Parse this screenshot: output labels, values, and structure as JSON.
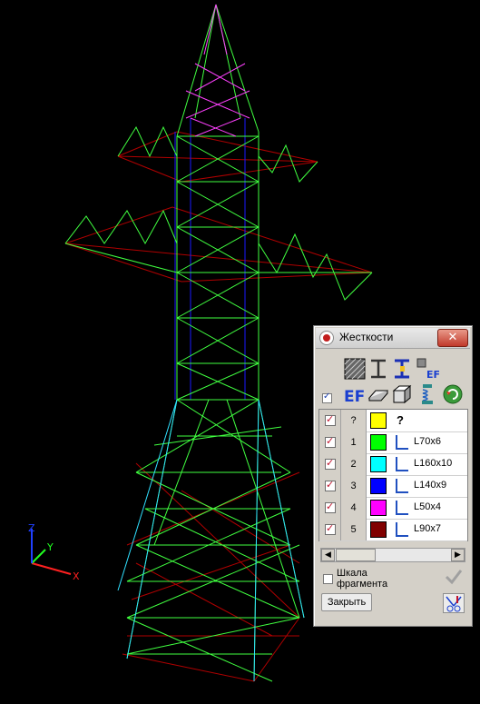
{
  "dialog": {
    "title": "Жесткости",
    "close_glyph": "✕",
    "toolbar_row1": [
      {
        "icon": "hatch-section-icon"
      },
      {
        "icon": "i-beam-icon"
      },
      {
        "icon": "i-beam-colored-icon"
      },
      {
        "icon": "ef-small-icon",
        "text": "EF"
      }
    ],
    "toolbar_row2": [
      {
        "icon": "ef-large-icon",
        "text": "EF"
      },
      {
        "icon": "plate-icon"
      },
      {
        "icon": "box-3d-icon"
      },
      {
        "icon": "spring-icon"
      },
      {
        "icon": "refresh-arrow-icon"
      }
    ],
    "select_all_checked": true,
    "rows": [
      {
        "checked": true,
        "number": "?",
        "color": "#ffff00",
        "shape": "unknown",
        "name": "?"
      },
      {
        "checked": true,
        "number": "1",
        "color": "#00ff00",
        "shape": "angle",
        "name": "L70x6"
      },
      {
        "checked": true,
        "number": "2",
        "color": "#00ffff",
        "shape": "angle",
        "name": "L160x10"
      },
      {
        "checked": true,
        "number": "3",
        "color": "#0000ff",
        "shape": "angle",
        "name": "L140x9"
      },
      {
        "checked": true,
        "number": "4",
        "color": "#ff00ff",
        "shape": "angle",
        "name": "L50x4"
      },
      {
        "checked": true,
        "number": "5",
        "color": "#800000",
        "shape": "angle",
        "name": "L90x7"
      }
    ],
    "scale_label": "Шкала фрагмента",
    "scale_checked": false,
    "close_button": "Закрыть",
    "scroll_left": "◀",
    "scroll_right": "▶"
  },
  "axes": {
    "x_label": "X",
    "y_label": "Y",
    "z_label": "Z",
    "x_color": "#ff2020",
    "y_color": "#20ff20",
    "z_color": "#2040ff"
  },
  "model": {
    "background": "#000000",
    "colors": {
      "green": "#40ff40",
      "red": "#c00000",
      "blue": "#1a1aff",
      "magenta": "#ff40ff",
      "cyan": "#30e0ff"
    }
  }
}
